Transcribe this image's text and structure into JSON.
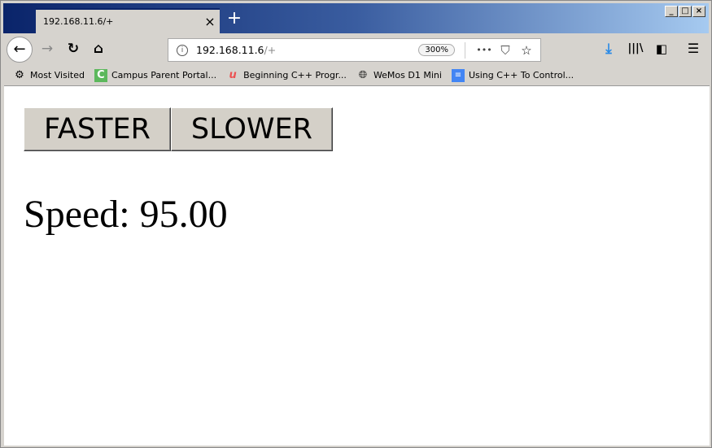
{
  "window": {
    "controls": [
      "minimize",
      "maximize",
      "close"
    ]
  },
  "tab": {
    "title": "192.168.11.6/+",
    "close": "×",
    "new_tab": "+"
  },
  "nav": {
    "back": "←",
    "forward": "→",
    "reload": "↻",
    "home": "⌂"
  },
  "url": {
    "host": "192.168.11.6",
    "path": "/+",
    "zoom": "300%",
    "more": "•••",
    "download_color": "#2a8ae6"
  },
  "bookmarks": [
    {
      "label": "Most Visited",
      "icon": "gear-icon"
    },
    {
      "label": "Campus Parent Portal...",
      "icon": "campus-c-icon",
      "color": "#5cb85c"
    },
    {
      "label": "Beginning C++ Progr...",
      "icon": "udemy-icon",
      "color": "#ec5252"
    },
    {
      "label": "WeMos D1 Mini",
      "icon": "globe-icon"
    },
    {
      "label": "Using C++ To Control...",
      "icon": "docs-icon",
      "color": "#4285f4"
    }
  ],
  "page": {
    "faster": "FASTER",
    "slower": "SLOWER",
    "speed": "Speed: 95.00"
  }
}
